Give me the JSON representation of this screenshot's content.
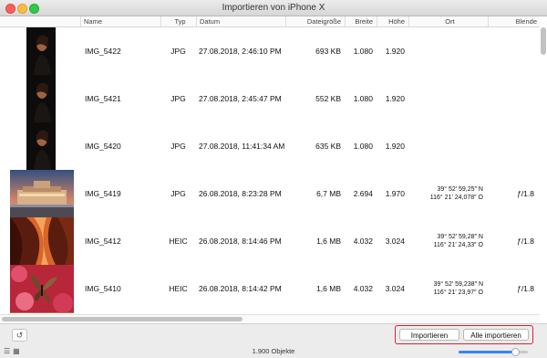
{
  "window": {
    "title": "Importieren von iPhone X"
  },
  "columns": [
    "Name",
    "Typ",
    "Datum",
    "Dateigröße",
    "Breite",
    "Höhe",
    "Ort",
    "Blende"
  ],
  "rows": [
    {
      "name": "IMG_5422",
      "type": "JPG",
      "date": "27.08.2018, 2:46:10 PM",
      "size": "693 KB",
      "width": "1.080",
      "height": "1.920",
      "loc1": "",
      "loc2": "",
      "aperture": "",
      "thumb": "portrait"
    },
    {
      "name": "IMG_5421",
      "type": "JPG",
      "date": "27.08.2018, 2:45:47 PM",
      "size": "552 KB",
      "width": "1.080",
      "height": "1.920",
      "loc1": "",
      "loc2": "",
      "aperture": "",
      "thumb": "portrait"
    },
    {
      "name": "IMG_5420",
      "type": "JPG",
      "date": "27.08.2018, 11:41:34 AM",
      "size": "635 KB",
      "width": "1.080",
      "height": "1.920",
      "loc1": "",
      "loc2": "",
      "aperture": "",
      "thumb": "portrait"
    },
    {
      "name": "IMG_5419",
      "type": "JPG",
      "date": "26.08.2018, 8:23:28 PM",
      "size": "6,7 MB",
      "width": "2.694",
      "height": "1.970",
      "loc1": "39° 52′ 59,25″ N",
      "loc2": "116° 21′ 24,078″ O",
      "aperture": "ƒ/1.8",
      "thumb": "building"
    },
    {
      "name": "IMG_5412",
      "type": "HEIC",
      "date": "26.08.2018, 8:14:46 PM",
      "size": "1,6 MB",
      "width": "4.032",
      "height": "3.024",
      "loc1": "39° 52′ 59,28″ N",
      "loc2": "116° 21′ 24,33″ O",
      "aperture": "ƒ/1.8",
      "thumb": "canyon"
    },
    {
      "name": "IMG_5410",
      "type": "HEIC",
      "date": "26.08.2018, 8:14:42 PM",
      "size": "1,6 MB",
      "width": "4.032",
      "height": "3.024",
      "loc1": "39° 52′ 59,238″ N",
      "loc2": "116° 21′ 23,97″ O",
      "aperture": "ƒ/1.8",
      "thumb": "butterfly"
    }
  ],
  "toolbar": {
    "rotate_icon": "rotate-icon",
    "import_label": "Importieren",
    "import_all_label": "Alle importieren"
  },
  "status": {
    "count_text": "1.900 Objekte"
  },
  "thumbnail_size": 0.82,
  "colors": {
    "highlight_border": "#e0222a",
    "slider_fill": "#3b83f6"
  }
}
